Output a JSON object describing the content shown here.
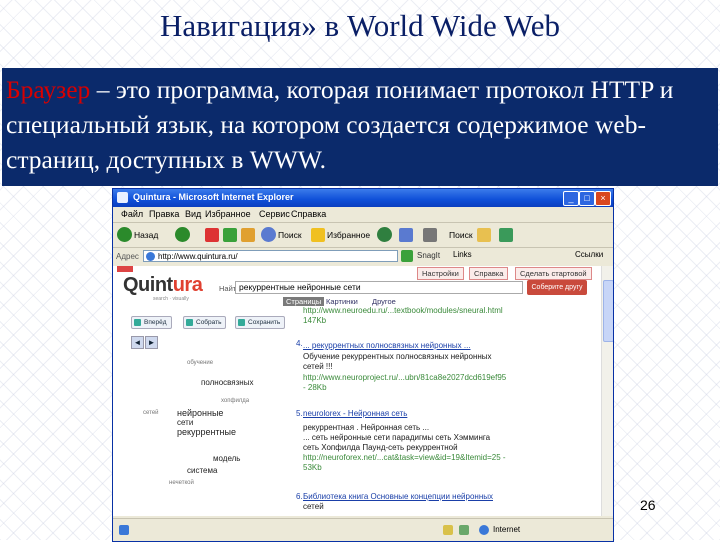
{
  "slide": {
    "title": "Навигация» в World Wide Web",
    "definition_term": "Браузер",
    "definition_rest": " – это программа, которая понимает протокол HTTP и специальный язык, на котором создается содержимое web-страниц, доступных в WWW.",
    "page_number": "26"
  },
  "window": {
    "title": "Quintura - Microsoft Internet Explorer",
    "menu": [
      "Файл",
      "Правка",
      "Вид",
      "Избранное",
      "Сервис",
      "Справка"
    ],
    "toolbar": {
      "back": "Назад",
      "search": "Поиск",
      "favorites": "Избранное",
      "links_label": "Поиск",
      "links": "Links",
      "snagit": "SnagIt"
    },
    "address": {
      "label": "Адрес",
      "url": "http://www.quintura.ru/",
      "links": "Ссылки"
    },
    "status": "Internet"
  },
  "page": {
    "logo": {
      "prefix": "Quint",
      "accent": "ura",
      "tagline": "search · visually"
    },
    "top_nav": [
      "Настройки",
      "Справка",
      "Сделать стартовой"
    ],
    "search_label": "Найти",
    "search_value": "рекуррентные нейронные сети",
    "search_button": "Соберите другу",
    "sub_tabs": [
      "Страницы",
      "Картинки",
      "Другое"
    ],
    "left_buttons": [
      "Вперёд",
      "Собрать",
      "Сохранить"
    ],
    "cloud": [
      "обучение",
      "полносвязных",
      "нейронные",
      "сети",
      "рекуррентные",
      "модель",
      "система",
      "нечеткой",
      "сетей",
      "хопфилда"
    ],
    "results": [
      {
        "num": "",
        "lines": [
          "http://www.neuroedu.ru/...textbook/modules/sneural.html",
          "147Kb"
        ]
      },
      {
        "num": "4.",
        "lines": [
          "... рекуррентных полносвязных нейронных ...",
          "Обучение рекуррентных полносвязных нейронных",
          "сетей !!!",
          "http://www.neuroproject.ru/...ubn/81ca8e2027dcd619ef95",
          "- 28Kb"
        ]
      },
      {
        "num": "5.",
        "lines": [
          "neurolorex - Нейронная сеть",
          "рекуррентная . Нейронная сеть ...",
          "... сеть нейронные сети парадигмы сеть Хэмминга",
          "сеть Хопфилда Паунд-сеть рекуррентной",
          "http://neuroforex.net/...cat&task=view&id=19&Itemid=25 -",
          "53Kb"
        ]
      },
      {
        "num": "6.",
        "lines": [
          "Библиотека книга Основные концепции нейронных",
          "сетей"
        ]
      }
    ]
  },
  "colors": {
    "title": "#0a1f66",
    "definition_bg": "#0b2a6b",
    "definition_term": "#d80000",
    "xp_titlebar": "#0f4fd8",
    "logo_accent": "#e04030"
  }
}
